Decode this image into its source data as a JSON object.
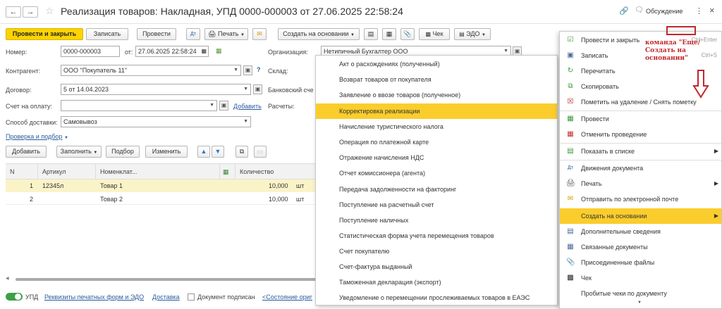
{
  "window": {
    "title": "Реализация товаров: Накладная, УПД 0000-000003 от 27.06.2025 22:58:24",
    "discussion": "Обсуждение"
  },
  "toolbar": {
    "post_close": "Провести и закрыть",
    "save": "Записать",
    "post": "Провести",
    "print": "Печать",
    "create_based": "Создать на основании",
    "check": "Чек",
    "edo": "ЭДО"
  },
  "form": {
    "number_label": "Номер:",
    "number_value": "0000-000003",
    "date_label": "от:",
    "date_value": "27.06.2025 22:58:24",
    "org_label": "Организация:",
    "org_value": "Нетипичный Бухгалтер ООО",
    "counterparty_label": "Контрагент:",
    "counterparty_value": "ООО \"Покупатель 11\"",
    "warehouse_label": "Склад:",
    "contract_label": "Договор:",
    "contract_value": "5 от 14.04.2023",
    "bank_label": "Банковский сче",
    "invoice_label": "Счет на оплату:",
    "invoice_add": "Добавить",
    "settlements_label": "Расчеты:",
    "delivery_label": "Способ доставки:",
    "delivery_value": "Самовывоз",
    "check_link": "Проверка и подбор"
  },
  "table_toolbar": {
    "add": "Добавить",
    "fill": "Заполнить",
    "select": "Подбор",
    "change": "Изменить"
  },
  "table": {
    "headers": {
      "n": "N",
      "article": "Артикул",
      "nomenclature": "Номенклат...",
      "quantity": "Количество"
    },
    "rows": [
      {
        "n": "1",
        "article": "12345л",
        "nomenclature": "Товар 1",
        "quantity": "10,000",
        "unit": "шт"
      },
      {
        "n": "2",
        "article": "",
        "nomenclature": "Товар 2",
        "quantity": "10,000",
        "unit": "шт"
      }
    ]
  },
  "footer": {
    "upd": "УПД",
    "print_forms": "Реквизиты печатных форм и ЭДО",
    "delivery": "Доставка",
    "signed": "Документ подписан",
    "state": "<Состояние ориг"
  },
  "dropdown": {
    "items": [
      "Акт о расхождениях (полученный)",
      "Возврат товаров от покупателя",
      "Заявление о ввозе товаров (полученное)",
      "Корректировка реализации",
      "Начисление туристического налога",
      "Операция по платежной карте",
      "Отражение начисления НДС",
      "Отчет комиссионера (агента)",
      "Передача задолженности на факторинг",
      "Поступление на расчетный счет",
      "Поступление наличных",
      "Статистическая форма учета перемещения товаров",
      "Счет покупателю",
      "Счет-фактура выданный",
      "Таможенная декларация (экспорт)",
      "Уведомление о перемещении прослеживаемых товаров в ЕАЭС"
    ],
    "highlighted_index": 3
  },
  "menu": {
    "post_close": "Провести и закрыть",
    "post_close_shortcut": "Ctrl+Enter",
    "save": "Записать",
    "save_shortcut": "Ctrl+S",
    "reread": "Перечитать",
    "copy": "Скопировать",
    "mark_delete": "Пометить на удаление / Снять пометку",
    "post": "Провести",
    "unpost": "Отменить проведение",
    "show_in_list": "Показать в списке",
    "movements": "Движения документа",
    "print": "Печать",
    "send_email": "Отправить по электронной почте",
    "create_based": "Создать на основании",
    "additional": "Дополнительные сведения",
    "related": "Связанные документы",
    "attached": "Присоединенные файлы",
    "check": "Чек",
    "punched": "Пробитые чеки по документу"
  },
  "annotation": {
    "text": "команда \"Еще/ Создать на основании\""
  },
  "colors": {
    "accent": "#fbd400",
    "highlight": "#fbcd2c",
    "row_selected": "#fbf3c8",
    "link": "#2a5c9c",
    "annotation": "#c0282c"
  }
}
